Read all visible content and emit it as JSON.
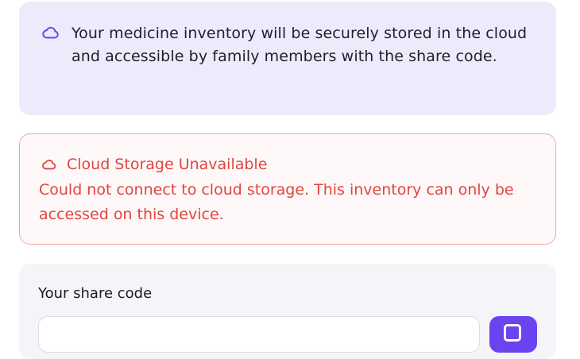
{
  "info": {
    "icon": "cloud-icon",
    "text": "Your medicine inventory will be securely stored in the cloud and accessible by family members with the share code."
  },
  "error": {
    "icon": "cloud-icon",
    "title": "Cloud Storage Unavailable",
    "text": "Could not connect to cloud storage. This inventory can only be accessed on this device."
  },
  "share": {
    "label": "Your share code",
    "copy_icon": "copy-icon"
  },
  "colors": {
    "accent": "#6b44f0",
    "info_bg": "#ecebfb",
    "error": "#e0453f",
    "error_border": "#f1a6a6"
  }
}
